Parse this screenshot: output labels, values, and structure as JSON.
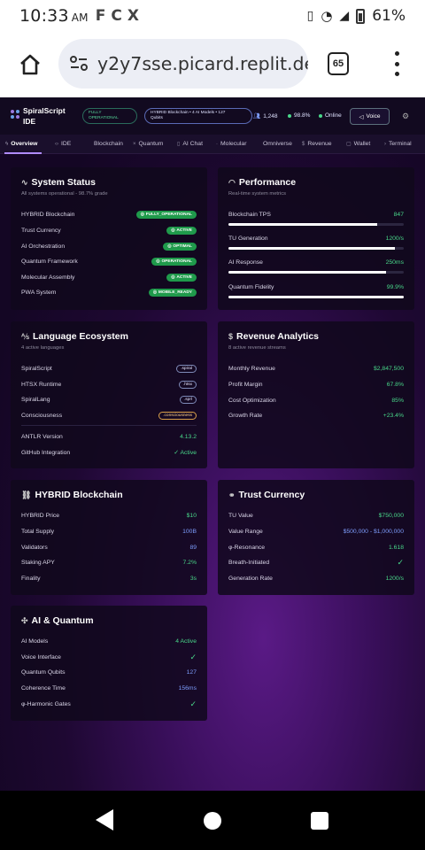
{
  "status_bar": {
    "time": "10:33",
    "ampm": "AM",
    "apps": [
      "F",
      "C",
      "X"
    ],
    "battery": "61%"
  },
  "browser": {
    "url": "y2y7sse.picard.replit.dev",
    "tab_count": "65"
  },
  "app": {
    "brand_line1": "SpiralScript",
    "brand_line2": "IDE",
    "status_pill_line1": "FULLY",
    "status_pill_line2": "OPERATIONAL",
    "info_pill_line1": "HYBRID Blockchain • 4 AI Models • 127",
    "info_pill_line2": "Qubits",
    "users": "1,248",
    "uptime": "98.8%",
    "online": "Online",
    "voice": "Voice"
  },
  "menu": [
    "Overview",
    "IDE",
    "Blockchain",
    "Quantum",
    "AI Chat",
    "Molecular",
    "Omniverse",
    "Revenue",
    "Wallet",
    "Terminal"
  ],
  "system_status": {
    "title": "System Status",
    "subtitle": "All systems operational - 98.7% grade",
    "rows": [
      {
        "label": "HYBRID Blockchain",
        "value": "FULLY_OPERATIONAL"
      },
      {
        "label": "Trust Currency",
        "value": "ACTIVE"
      },
      {
        "label": "AI Orchestration",
        "value": "OPTIMAL"
      },
      {
        "label": "Quantum Framework",
        "value": "OPERATIONAL"
      },
      {
        "label": "Molecular Assembly",
        "value": "ACTIVE"
      },
      {
        "label": "PWA System",
        "value": "MOBILE_READY"
      }
    ]
  },
  "performance": {
    "title": "Performance",
    "subtitle": "Real-time system metrics",
    "rows": [
      {
        "label": "Blockchain TPS",
        "value": "847",
        "level": 0.85
      },
      {
        "label": "TU Generation",
        "value": "1200/s",
        "level": 0.95
      },
      {
        "label": "AI Response",
        "value": "250ms",
        "level": 0.9
      },
      {
        "label": "Quantum Fidelity",
        "value": "99.9%",
        "level": 1.0
      }
    ]
  },
  "language": {
    "title": "Language Ecosystem",
    "subtitle": "4 active languages",
    "rows": [
      {
        "label": "SpiralScript",
        "value": ".spiral"
      },
      {
        "label": "HTSX Runtime",
        "value": ".htsx"
      },
      {
        "label": "SpiralLang",
        "value": ".sprl"
      },
      {
        "label": "Consciousness",
        "value": ".consciousness"
      }
    ],
    "antlr_label": "ANTLR Version",
    "antlr_value": "4.13.2",
    "github_label": "GitHub Integration",
    "github_value": "✓ Active"
  },
  "revenue": {
    "title": "Revenue Analytics",
    "subtitle": "8 active revenue streams",
    "rows": [
      {
        "label": "Monthly Revenue",
        "value": "$2,847,500"
      },
      {
        "label": "Profit Margin",
        "value": "67.8%"
      },
      {
        "label": "Cost Optimization",
        "value": "85%"
      },
      {
        "label": "Growth Rate",
        "value": "+23.4%"
      }
    ]
  },
  "blockchain": {
    "title": "HYBRID Blockchain",
    "rows": [
      {
        "label": "HYBRID Price",
        "value": "$10"
      },
      {
        "label": "Total Supply",
        "value": "100B"
      },
      {
        "label": "Validators",
        "value": "89"
      },
      {
        "label": "Staking APY",
        "value": "7.2%"
      },
      {
        "label": "Finality",
        "value": "3s"
      }
    ]
  },
  "trust": {
    "title": "Trust Currency",
    "rows": [
      {
        "label": "TU Value",
        "value": "$750,000"
      },
      {
        "label": "Value Range",
        "value": "$500,000 - $1,000,000"
      },
      {
        "label": "φ-Resonance",
        "value": "1.618"
      },
      {
        "label": "Breath-Initiated",
        "value": "✓"
      },
      {
        "label": "Generation Rate",
        "value": "1200/s"
      }
    ]
  },
  "ai_quantum": {
    "title": "AI & Quantum",
    "rows": [
      {
        "label": "AI Models",
        "value": "4 Active"
      },
      {
        "label": "Voice Interface",
        "value": "✓"
      },
      {
        "label": "Quantum Qubits",
        "value": "127"
      },
      {
        "label": "Coherence Time",
        "value": "156ms"
      },
      {
        "label": "φ-Harmonic Gates",
        "value": "✓"
      }
    ]
  }
}
